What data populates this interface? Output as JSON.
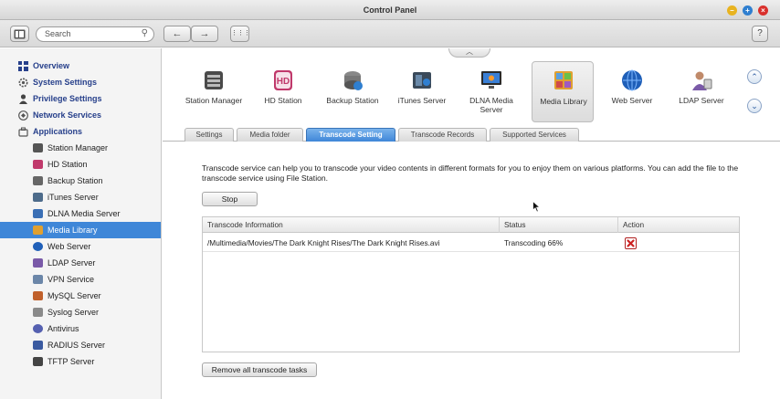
{
  "window": {
    "title": "Control Panel"
  },
  "toolbar": {
    "search_placeholder": "Search",
    "back_glyph": "←",
    "forward_glyph": "→",
    "grid_glyph": "⋮⋮⋮",
    "help_label": "?",
    "magnifier_glyph": "⚲"
  },
  "sidebar": {
    "headers": [
      {
        "label": "Overview",
        "icon": "overview-icon"
      },
      {
        "label": "System Settings",
        "icon": "gear-icon"
      },
      {
        "label": "Privilege Settings",
        "icon": "user-icon"
      },
      {
        "label": "Network Services",
        "icon": "network-icon"
      },
      {
        "label": "Applications",
        "icon": "applications-icon"
      }
    ],
    "items": [
      {
        "label": "Station Manager",
        "color": "#555555"
      },
      {
        "label": "HD Station",
        "color": "#c0396b"
      },
      {
        "label": "Backup Station",
        "color": "#666666"
      },
      {
        "label": "iTunes Server",
        "color": "#4d6b8a"
      },
      {
        "label": "DLNA Media Server",
        "color": "#3a6fb5"
      },
      {
        "label": "Media Library",
        "color": "#e0a030"
      },
      {
        "label": "Web Server",
        "color": "#1f5fb8"
      },
      {
        "label": "LDAP Server",
        "color": "#7a5aa8"
      },
      {
        "label": "VPN Service",
        "color": "#6b86a8"
      },
      {
        "label": "MySQL Server",
        "color": "#c0602b"
      },
      {
        "label": "Syslog Server",
        "color": "#8a8a8a"
      },
      {
        "label": "Antivirus",
        "color": "#5560b0"
      },
      {
        "label": "RADIUS Server",
        "color": "#3a5aa0"
      },
      {
        "label": "TFTP Server",
        "color": "#444444"
      }
    ]
  },
  "apps": [
    {
      "label": "Station Manager",
      "icon": "station-manager-icon"
    },
    {
      "label": "HD Station",
      "icon": "hd-station-icon",
      "badge": "HD"
    },
    {
      "label": "Backup Station",
      "icon": "backup-station-icon"
    },
    {
      "label": "iTunes Server",
      "icon": "itunes-server-icon"
    },
    {
      "label": "DLNA Media Server",
      "icon": "dlna-media-server-icon"
    },
    {
      "label": "Media Library",
      "icon": "media-library-icon"
    },
    {
      "label": "Web Server",
      "icon": "web-server-icon"
    },
    {
      "label": "LDAP Server",
      "icon": "ldap-server-icon"
    }
  ],
  "tabs": [
    "Settings",
    "Media folder",
    "Transcode Setting",
    "Transcode Records",
    "Supported Services"
  ],
  "content": {
    "description": "Transcode service can help you to transcode your video contents in different formats for you to enjoy them on various platforms. You can add the file to the transcode service using File Station.",
    "stop_label": "Stop",
    "remove_all_label": "Remove all transcode tasks",
    "table": {
      "headers": [
        "Transcode Information",
        "Status",
        "Action"
      ],
      "rows": [
        {
          "info": "/Multimedia/Movies/The Dark Knight Rises/The Dark Knight Rises.avi",
          "status": "Transcoding 66%"
        }
      ]
    }
  },
  "colors": {
    "accent": "#3f87d8",
    "sidebar_header": "#27408b",
    "delete": "#cc2222"
  }
}
